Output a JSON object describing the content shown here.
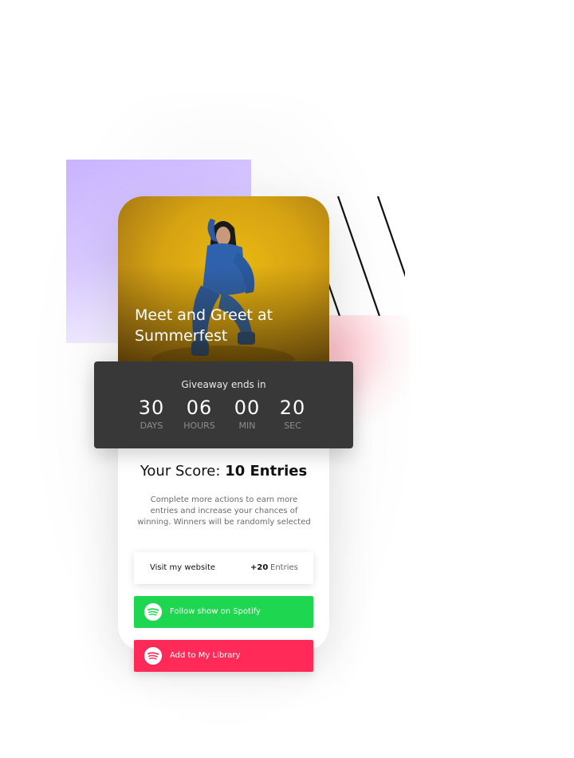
{
  "event": {
    "title_line1": "Meet and Greet at",
    "title_line2": "Summerfest"
  },
  "countdown": {
    "label": "Giveaway ends in",
    "units": [
      {
        "value": "30",
        "label": "DAYS"
      },
      {
        "value": "06",
        "label": "HOURS"
      },
      {
        "value": "00",
        "label": "MIN"
      },
      {
        "value": "20",
        "label": "SEC"
      }
    ]
  },
  "score": {
    "prefix": "Your Score:",
    "value": "10 Entries",
    "description": "Complete more actions to earn more entries and increase your chances of winning. Winners will be randomly selected"
  },
  "actions": {
    "website": {
      "label": "Visit my website",
      "points": "+20",
      "unit": "Entries"
    },
    "spotify_follow": {
      "label": "Follow show on Spotify",
      "icon": "spotify-icon"
    },
    "library": {
      "label": "Add to My Library",
      "icon": "spotify-icon"
    }
  },
  "colors": {
    "spotify_green": "#1ed650",
    "library_pink": "#ff2a57",
    "countdown_bg": "#383838",
    "accent_purple": "#c9b4ff"
  }
}
